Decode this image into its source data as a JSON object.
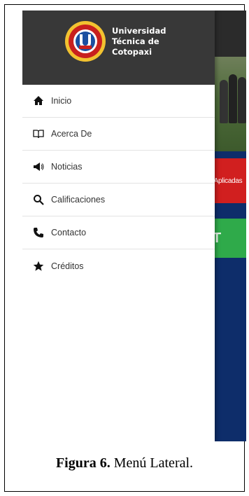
{
  "drawer": {
    "brand": [
      "Universidad",
      "Técnica de",
      "Cotopaxi"
    ],
    "logo_icon": "utc-seal-logo",
    "items": [
      {
        "label": "Inicio",
        "icon": "home-icon"
      },
      {
        "label": "Acerca De",
        "icon": "book-icon"
      },
      {
        "label": "Noticias",
        "icon": "megaphone-icon"
      },
      {
        "label": "Calificaciones",
        "icon": "search-icon"
      },
      {
        "label": "Contacto",
        "icon": "phone-icon"
      },
      {
        "label": "Créditos",
        "icon": "star-icon"
      }
    ]
  },
  "background": {
    "red_button_label": "Aplicadas",
    "green_button_label": "T"
  },
  "colors": {
    "header_bg": "#383838",
    "page_blue": "#0e2d6a",
    "red_tile": "#d11f1f",
    "green_tile": "#2faa4a"
  },
  "caption": {
    "figure": "Figura 6.",
    "text": " Menú Lateral."
  }
}
